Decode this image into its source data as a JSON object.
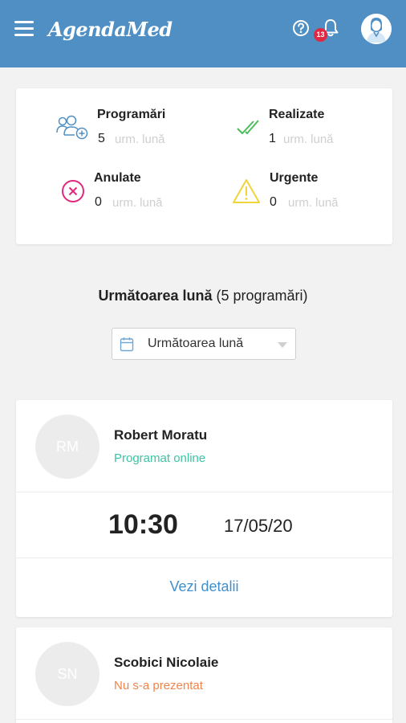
{
  "header": {
    "brand": "AgendaMed",
    "notification_count": "13",
    "colors": {
      "bar": "#4f8fc4",
      "badge": "#e02843"
    }
  },
  "stats": [
    {
      "label": "Programări",
      "count": "5",
      "sub": "urm. lună",
      "icon": "users-add-icon",
      "color": "#4f8fc4"
    },
    {
      "label": "Realizate",
      "count": "1",
      "sub": "urm. lună",
      "icon": "double-check-icon",
      "color": "#4cbb5c"
    },
    {
      "label": "Anulate",
      "count": "0",
      "sub": "urm. lună",
      "icon": "cancel-circle-icon",
      "color": "#e0287d"
    },
    {
      "label": "Urgente",
      "count": "0",
      "sub": "urm. lună",
      "icon": "warning-icon",
      "color": "#f1d33a"
    }
  ],
  "section": {
    "title_bold": "Următoarea lună",
    "title_rest": "(5 programări)"
  },
  "filter": {
    "selected": "Următoarea lună"
  },
  "appointments": [
    {
      "initials": "RM",
      "name": "Robert Moratu",
      "status": "Programat online",
      "status_color": "#3cc4a4",
      "time": "10:30",
      "date": "17/05/20",
      "link": "Vezi detalii"
    },
    {
      "initials": "SN",
      "name": "Scobici Nicolaie",
      "status": "Nu s-a prezentat",
      "status_color": "#f0844a"
    }
  ]
}
